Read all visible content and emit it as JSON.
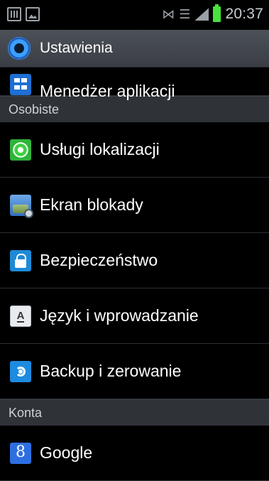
{
  "status_bar": {
    "left_icons": [
      "sd-card-icon",
      "image-notification-icon"
    ],
    "right_icons": [
      "no-sim-icon",
      "wifi-icon",
      "signal-icon",
      "battery-icon"
    ],
    "time": "20:37",
    "battery_color": "#48e23c"
  },
  "action_bar": {
    "title": "Ustawienia",
    "icon": "settings-gear-icon"
  },
  "list": {
    "top_partial": {
      "label": "Menedżer aplikacji",
      "icon": "apps-grid-icon"
    },
    "sections": [
      {
        "header": "Osobiste",
        "items": [
          {
            "label": "Usługi lokalizacji",
            "icon": "location-icon"
          },
          {
            "label": "Ekran blokady",
            "icon": "lock-screen-icon"
          },
          {
            "label": "Bezpieczeństwo",
            "icon": "padlock-icon"
          },
          {
            "label": "Język i wprowadzanie",
            "icon": "keyboard-language-icon",
            "icon_glyph": "A"
          },
          {
            "label": "Backup i zerowanie",
            "icon": "backup-reset-icon"
          }
        ]
      },
      {
        "header": "Konta",
        "items": [
          {
            "label": "Google",
            "icon": "google-icon",
            "icon_glyph": "8"
          }
        ]
      }
    ]
  }
}
